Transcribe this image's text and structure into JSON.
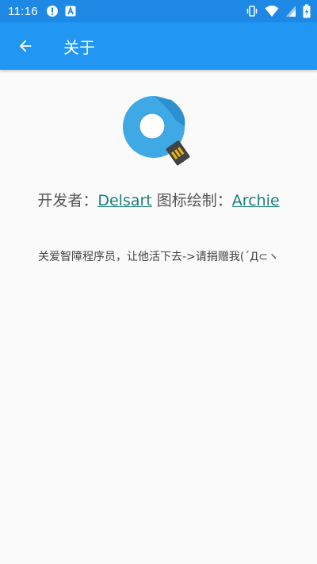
{
  "status_bar": {
    "time": "11:16",
    "left_icons": [
      "alert-icon",
      "a-icon"
    ],
    "right_icons": [
      "vibrate-icon",
      "wifi-icon",
      "signal-icon",
      "battery-icon"
    ]
  },
  "app_bar": {
    "title": "关于",
    "back_icon": "arrow-back-icon",
    "color": "#2196f3"
  },
  "about": {
    "developer_prefix": "开发者：",
    "developer_name": "Delsart",
    "icon_prefix": " 图标绘制：",
    "icon_artist": "Archie",
    "donate_text": "关爱智障程序员，让他活下去->请捐赠我(´Д⊂ヽ",
    "link_color": "#1b7f78"
  }
}
